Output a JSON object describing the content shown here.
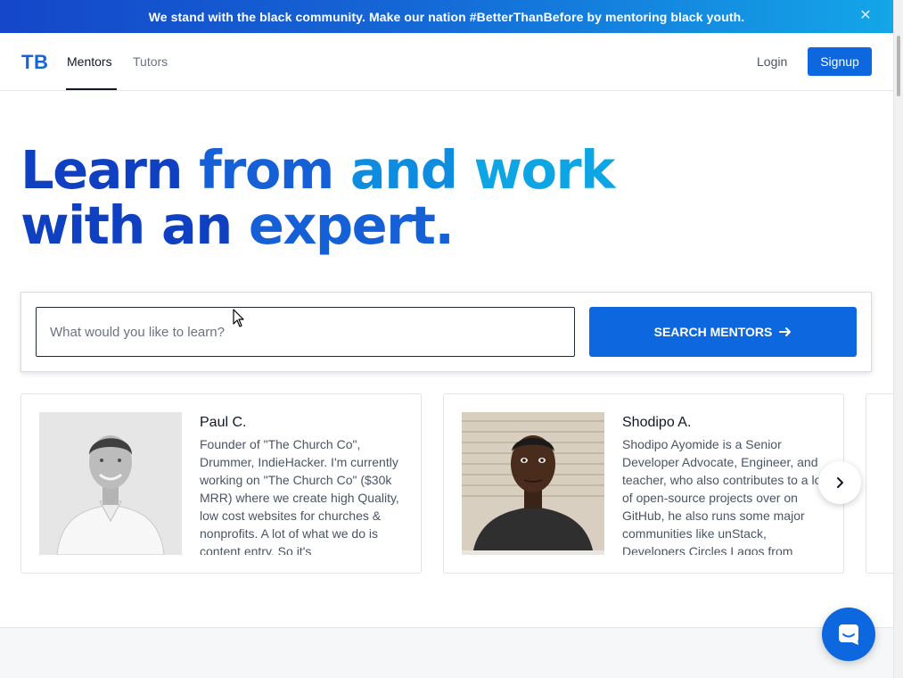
{
  "banner": {
    "text": "We stand with the black community. Make our nation #BetterThanBefore by mentoring black youth.",
    "close_icon": "close-icon"
  },
  "nav": {
    "logo": "TB",
    "tabs": [
      {
        "label": "Mentors",
        "active": true
      },
      {
        "label": "Tutors",
        "active": false
      }
    ],
    "login_label": "Login",
    "signup_label": "Signup"
  },
  "hero": {
    "line1_word1": "Learn",
    "line1_word2": "from",
    "line1_word3": "and",
    "line1_word4": "work",
    "line2_word1": "with",
    "line2_word2": "an",
    "line2_word3": "expert."
  },
  "search": {
    "placeholder": "What would you like to learn?",
    "value": "",
    "button_label": "SEARCH MENTORS",
    "button_icon": "arrow-right-icon"
  },
  "mentors": [
    {
      "name": "Paul C.",
      "bio": "Founder of \"The Church Co\", Drummer, IndieHacker. I'm currently working on \"The Church Co\" ($30k MRR) where we create high Quality, low cost websites for churches & nonprofits. A lot of what we do is content entry. So it's"
    },
    {
      "name": "Shodipo A.",
      "bio": "Shodipo Ayomide is a Senior Developer Advocate, Engineer, and teacher, who also contributes to a lot of open-source projects over on GitHub, he also runs some major communities like unStack, Developers Circles Lagos from"
    }
  ],
  "carousel": {
    "next_icon": "chevron-right-icon"
  },
  "chat": {
    "icon": "chat-icon"
  },
  "colors": {
    "primary": "#0d68e0",
    "hero_dark": "#0f40c2",
    "hero_mid": "#1560d6",
    "hero_light": "#0ea5e5"
  }
}
